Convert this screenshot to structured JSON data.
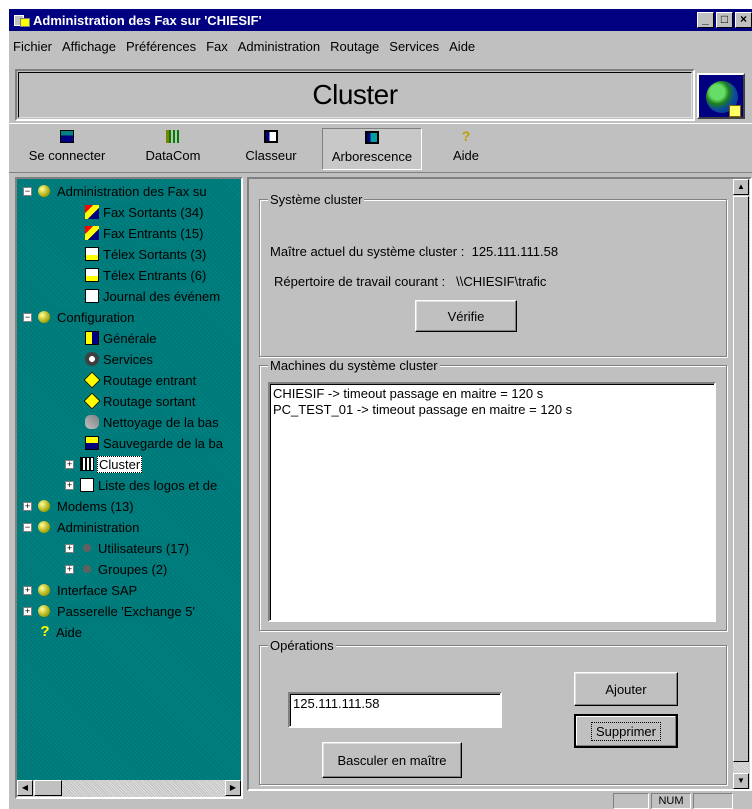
{
  "window": {
    "title": "Administration des Fax sur 'CHIESIF'",
    "controls": {
      "minimize": "_",
      "maximize": "□",
      "close": "×"
    }
  },
  "menu": [
    {
      "label": "Fichier"
    },
    {
      "label": "Affichage"
    },
    {
      "label": "Préférences"
    },
    {
      "label": "Fax"
    },
    {
      "label": "Administration"
    },
    {
      "label": "Routage"
    },
    {
      "label": "Services"
    },
    {
      "label": "Aide"
    }
  ],
  "header": {
    "title": "Cluster",
    "logo_icon": "globe-icon"
  },
  "toolbar": {
    "connect": {
      "label": "Se connecter",
      "icon": "connect-icon"
    },
    "datacom": {
      "label": "DataCom",
      "icon": "datacom-icon"
    },
    "classeur": {
      "label": "Classeur",
      "icon": "classeur-icon"
    },
    "arborescence": {
      "label": "Arborescence",
      "icon": "tree-icon",
      "pressed": true
    },
    "aide": {
      "label": "Aide",
      "icon": "help-icon"
    }
  },
  "tree": [
    {
      "label": "Administration des Fax su",
      "level": 0,
      "expander": "−",
      "icon": "ball"
    },
    {
      "label": "Fax Sortants (34)",
      "level": 1,
      "icon": "fax"
    },
    {
      "label": "Fax Entrants (15)",
      "level": 1,
      "icon": "fax"
    },
    {
      "label": "Télex Sortants (3)",
      "level": 1,
      "icon": "telex"
    },
    {
      "label": "Télex Entrants (6)",
      "level": 1,
      "icon": "telex"
    },
    {
      "label": "Journal des événem",
      "level": 1,
      "icon": "journal"
    },
    {
      "label": "Configuration",
      "level": 0,
      "expander": "−",
      "icon": "ball"
    },
    {
      "label": "Générale",
      "level": 1,
      "icon": "gen"
    },
    {
      "label": "Services",
      "level": 1,
      "icon": "svc"
    },
    {
      "label": "Routage entrant",
      "level": 1,
      "icon": "route"
    },
    {
      "label": "Routage sortant",
      "level": 1,
      "icon": "route"
    },
    {
      "label": "Nettoyage de la bas",
      "level": 1,
      "icon": "clean"
    },
    {
      "label": "Sauvegarde de la ba",
      "level": 1,
      "icon": "save"
    },
    {
      "label": "Cluster",
      "level": 1,
      "expander": "+",
      "icon": "cluster",
      "selected": true
    },
    {
      "label": "Liste des logos et de",
      "level": 1,
      "expander": "+",
      "icon": "journal"
    },
    {
      "label": "Modems (13)",
      "level": 0,
      "expander": "+",
      "icon": "ball"
    },
    {
      "label": "Administration",
      "level": 0,
      "expander": "−",
      "icon": "ball"
    },
    {
      "label": "Utilisateurs (17)",
      "level": 1,
      "expander": "+",
      "icon": "users"
    },
    {
      "label": "Groupes (2)",
      "level": 1,
      "expander": "+",
      "icon": "users"
    },
    {
      "label": "Interface SAP",
      "level": 0,
      "expander": "+",
      "icon": "ball"
    },
    {
      "label": "Passerelle 'Exchange 5'",
      "level": 0,
      "expander": "+",
      "icon": "ball"
    },
    {
      "label": "Aide",
      "level": 0,
      "icon": "help"
    }
  ],
  "cluster_system": {
    "legend": "Système cluster",
    "master_label": "Maître actuel du système cluster :",
    "master_value": "125.111.111.58",
    "workdir_label": "Répertoire de travail courant :",
    "workdir_value": "\\\\CHIESIF\\trafic",
    "verify_button": "Vérifie"
  },
  "machines": {
    "legend": "Machines du système cluster",
    "items": [
      "CHIESIF  -> timeout passage en maitre = 120 s",
      "PC_TEST_01  -> timeout passage en maitre = 120 s"
    ]
  },
  "operations": {
    "legend": "Opérations",
    "address_value": "125.111.111.58",
    "add_button": "Ajouter",
    "delete_button": "Supprimer",
    "switch_master_button": "Basculer en maître"
  },
  "statusbar": {
    "num": "NUM"
  }
}
